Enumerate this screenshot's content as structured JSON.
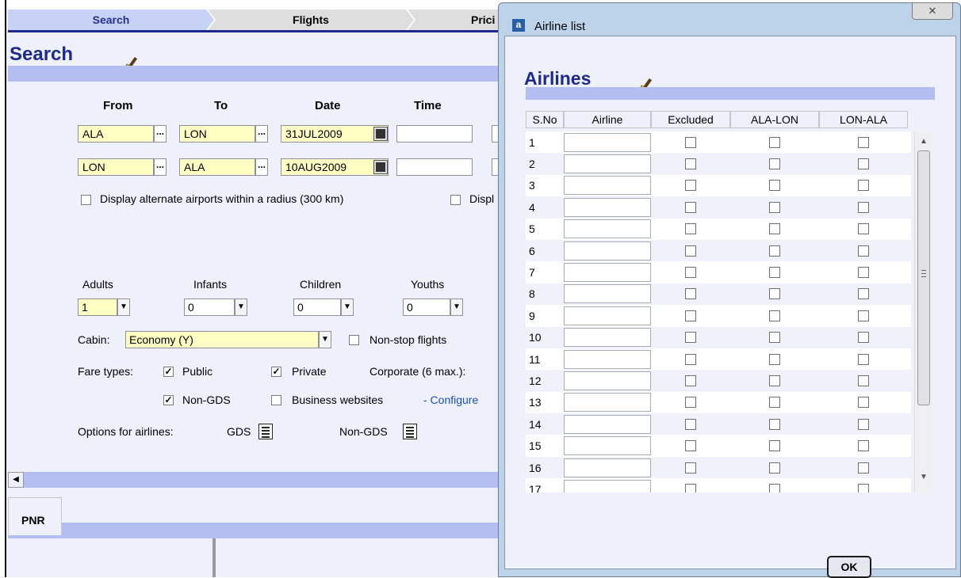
{
  "steps": [
    "Search",
    "Flights",
    "Prici"
  ],
  "search": {
    "title": "Search",
    "headers": {
      "from": "From",
      "to": "To",
      "date": "Date",
      "time": "Time"
    },
    "legs": [
      {
        "from": "ALA",
        "to": "LON",
        "date": "31JUL2009"
      },
      {
        "from": "LON",
        "to": "ALA",
        "date": "10AUG2009"
      }
    ],
    "alt_airports_label": "Display alternate airports within a radius (300 km)",
    "display_partial_label": "Displ",
    "passengers": {
      "adults_label": "Adults",
      "adults_value": "1",
      "infants_label": "Infants",
      "infants_value": "0",
      "children_label": "Children",
      "children_value": "0",
      "youths_label": "Youths",
      "youths_value": "0"
    },
    "cabin_label": "Cabin:",
    "cabin_value": "Economy (Y)",
    "nonstop_label": "Non-stop flights",
    "fare_types_label": "Fare types:",
    "fare_public": "Public",
    "fare_private": "Private",
    "corporate_label": "Corporate (6 max.):",
    "fare_nongds": "Non-GDS",
    "fare_business": "Business websites",
    "configure_link": "- Configure",
    "options_label": "Options for airlines:",
    "gds_label": "GDS",
    "nongds_label": "Non-GDS"
  },
  "pnr_tab": "PNR",
  "dialog": {
    "title": "Airline list",
    "heading": "Airlines",
    "close": "✕",
    "columns": [
      "S.No",
      "Airline",
      "Excluded",
      "ALA-LON",
      "LON-ALA"
    ],
    "rows": [
      "1",
      "2",
      "3",
      "4",
      "5",
      "6",
      "7",
      "8",
      "9",
      "10",
      "11",
      "12",
      "13",
      "14",
      "15",
      "16",
      "17"
    ],
    "ok": "OK"
  },
  "colors": {
    "accent": "#1c2a8f",
    "strip": "#b4bef0",
    "panel": "#eef0fb",
    "field_yellow": "#ffffc4"
  }
}
